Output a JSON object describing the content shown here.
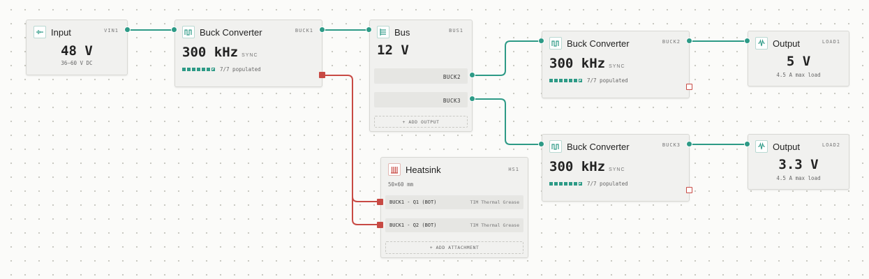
{
  "colors": {
    "wire_power": "#2d9a86",
    "wire_thermal": "#c84a44",
    "canvas": "#fbfbf9",
    "node_bg": "#f1f1ef"
  },
  "input": {
    "title": "Input",
    "ref": "VIN1",
    "value": "48 V",
    "sub": "36–60 V DC",
    "icon": "dc-source-icon"
  },
  "buck1": {
    "title": "Buck Converter",
    "ref": "BUCK1",
    "value": "300 kHz",
    "mode": "SYNC",
    "populated": "7/7 populated",
    "icon": "switching-waveform-icon"
  },
  "bus": {
    "title": "Bus",
    "ref": "BUS1",
    "value": "12 V",
    "icon": "bus-rail-icon",
    "outputs": [
      "BUCK2",
      "BUCK3"
    ],
    "add_output": "+ ADD OUTPUT"
  },
  "buck2": {
    "title": "Buck Converter",
    "ref": "BUCK2",
    "value": "300 kHz",
    "mode": "SYNC",
    "populated": "7/7 populated",
    "icon": "switching-waveform-icon"
  },
  "buck3": {
    "title": "Buck Converter",
    "ref": "BUCK3",
    "value": "300 kHz",
    "mode": "SYNC",
    "populated": "7/7 populated",
    "icon": "switching-waveform-icon"
  },
  "load1": {
    "title": "Output",
    "ref": "LOAD1",
    "value": "5 V",
    "sub": "4.5 A max load",
    "icon": "load-waveform-icon"
  },
  "load2": {
    "title": "Output",
    "ref": "LOAD2",
    "value": "3.3 V",
    "sub": "4.5 A max load",
    "icon": "load-waveform-icon"
  },
  "heatsink": {
    "title": "Heatsink",
    "ref": "HS1",
    "size": "50×60 mm",
    "icon": "heatsink-icon",
    "attachments": [
      {
        "part": "BUCK1 - Q1 (BOT)",
        "tim": "TIM Thermal Grease"
      },
      {
        "part": "BUCK1 - Q2 (BOT)",
        "tim": "TIM Thermal Grease"
      }
    ],
    "add_attachment": "+ ADD ATTACHMENT"
  }
}
